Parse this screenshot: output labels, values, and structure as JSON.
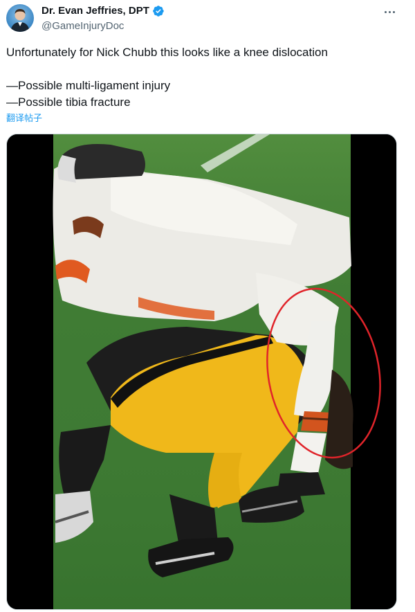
{
  "author": {
    "name": "Dr. Evan Jeffries, DPT",
    "handle": "@GameInjuryDoc",
    "verified": true,
    "avatar_icon": "avatar-icon",
    "verified_icon": "verified-badge-icon"
  },
  "tweet": {
    "line1": "Unfortunately for Nick Chubb this looks like a knee dislocation",
    "line2": "—Possible multi-ligament injury",
    "line3": "—Possible tibia fracture"
  },
  "translate_label": "翻译帖子",
  "more_icon": "more-options-icon",
  "colors": {
    "link": "#1d9bf0",
    "text": "#0f1419",
    "secondary": "#536471",
    "annotation_circle": "#e0242a",
    "field_green": "#3d7a32",
    "steelers_yellow": "#f0b81a",
    "browns_orange": "#e05a20"
  }
}
